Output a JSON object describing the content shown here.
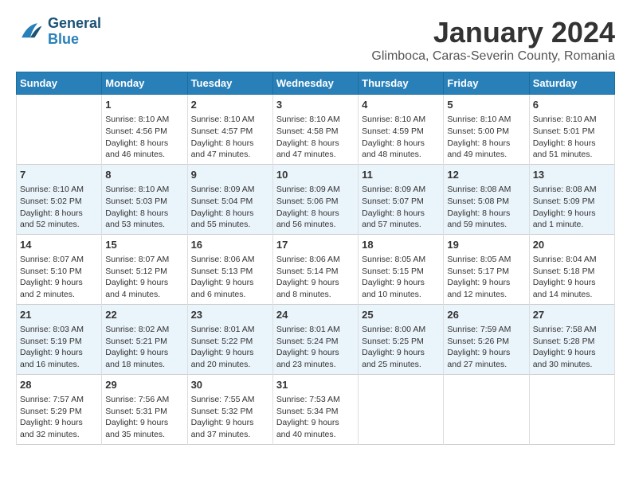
{
  "header": {
    "logo_line1": "General",
    "logo_line2": "Blue",
    "month": "January 2024",
    "location": "Glimboca, Caras-Severin County, Romania"
  },
  "columns": [
    "Sunday",
    "Monday",
    "Tuesday",
    "Wednesday",
    "Thursday",
    "Friday",
    "Saturday"
  ],
  "weeks": [
    [
      {
        "day": "",
        "info": ""
      },
      {
        "day": "1",
        "info": "Sunrise: 8:10 AM\nSunset: 4:56 PM\nDaylight: 8 hours\nand 46 minutes."
      },
      {
        "day": "2",
        "info": "Sunrise: 8:10 AM\nSunset: 4:57 PM\nDaylight: 8 hours\nand 47 minutes."
      },
      {
        "day": "3",
        "info": "Sunrise: 8:10 AM\nSunset: 4:58 PM\nDaylight: 8 hours\nand 47 minutes."
      },
      {
        "day": "4",
        "info": "Sunrise: 8:10 AM\nSunset: 4:59 PM\nDaylight: 8 hours\nand 48 minutes."
      },
      {
        "day": "5",
        "info": "Sunrise: 8:10 AM\nSunset: 5:00 PM\nDaylight: 8 hours\nand 49 minutes."
      },
      {
        "day": "6",
        "info": "Sunrise: 8:10 AM\nSunset: 5:01 PM\nDaylight: 8 hours\nand 51 minutes."
      }
    ],
    [
      {
        "day": "7",
        "info": "Sunrise: 8:10 AM\nSunset: 5:02 PM\nDaylight: 8 hours\nand 52 minutes."
      },
      {
        "day": "8",
        "info": "Sunrise: 8:10 AM\nSunset: 5:03 PM\nDaylight: 8 hours\nand 53 minutes."
      },
      {
        "day": "9",
        "info": "Sunrise: 8:09 AM\nSunset: 5:04 PM\nDaylight: 8 hours\nand 55 minutes."
      },
      {
        "day": "10",
        "info": "Sunrise: 8:09 AM\nSunset: 5:06 PM\nDaylight: 8 hours\nand 56 minutes."
      },
      {
        "day": "11",
        "info": "Sunrise: 8:09 AM\nSunset: 5:07 PM\nDaylight: 8 hours\nand 57 minutes."
      },
      {
        "day": "12",
        "info": "Sunrise: 8:08 AM\nSunset: 5:08 PM\nDaylight: 8 hours\nand 59 minutes."
      },
      {
        "day": "13",
        "info": "Sunrise: 8:08 AM\nSunset: 5:09 PM\nDaylight: 9 hours\nand 1 minute."
      }
    ],
    [
      {
        "day": "14",
        "info": "Sunrise: 8:07 AM\nSunset: 5:10 PM\nDaylight: 9 hours\nand 2 minutes."
      },
      {
        "day": "15",
        "info": "Sunrise: 8:07 AM\nSunset: 5:12 PM\nDaylight: 9 hours\nand 4 minutes."
      },
      {
        "day": "16",
        "info": "Sunrise: 8:06 AM\nSunset: 5:13 PM\nDaylight: 9 hours\nand 6 minutes."
      },
      {
        "day": "17",
        "info": "Sunrise: 8:06 AM\nSunset: 5:14 PM\nDaylight: 9 hours\nand 8 minutes."
      },
      {
        "day": "18",
        "info": "Sunrise: 8:05 AM\nSunset: 5:15 PM\nDaylight: 9 hours\nand 10 minutes."
      },
      {
        "day": "19",
        "info": "Sunrise: 8:05 AM\nSunset: 5:17 PM\nDaylight: 9 hours\nand 12 minutes."
      },
      {
        "day": "20",
        "info": "Sunrise: 8:04 AM\nSunset: 5:18 PM\nDaylight: 9 hours\nand 14 minutes."
      }
    ],
    [
      {
        "day": "21",
        "info": "Sunrise: 8:03 AM\nSunset: 5:19 PM\nDaylight: 9 hours\nand 16 minutes."
      },
      {
        "day": "22",
        "info": "Sunrise: 8:02 AM\nSunset: 5:21 PM\nDaylight: 9 hours\nand 18 minutes."
      },
      {
        "day": "23",
        "info": "Sunrise: 8:01 AM\nSunset: 5:22 PM\nDaylight: 9 hours\nand 20 minutes."
      },
      {
        "day": "24",
        "info": "Sunrise: 8:01 AM\nSunset: 5:24 PM\nDaylight: 9 hours\nand 23 minutes."
      },
      {
        "day": "25",
        "info": "Sunrise: 8:00 AM\nSunset: 5:25 PM\nDaylight: 9 hours\nand 25 minutes."
      },
      {
        "day": "26",
        "info": "Sunrise: 7:59 AM\nSunset: 5:26 PM\nDaylight: 9 hours\nand 27 minutes."
      },
      {
        "day": "27",
        "info": "Sunrise: 7:58 AM\nSunset: 5:28 PM\nDaylight: 9 hours\nand 30 minutes."
      }
    ],
    [
      {
        "day": "28",
        "info": "Sunrise: 7:57 AM\nSunset: 5:29 PM\nDaylight: 9 hours\nand 32 minutes."
      },
      {
        "day": "29",
        "info": "Sunrise: 7:56 AM\nSunset: 5:31 PM\nDaylight: 9 hours\nand 35 minutes."
      },
      {
        "day": "30",
        "info": "Sunrise: 7:55 AM\nSunset: 5:32 PM\nDaylight: 9 hours\nand 37 minutes."
      },
      {
        "day": "31",
        "info": "Sunrise: 7:53 AM\nSunset: 5:34 PM\nDaylight: 9 hours\nand 40 minutes."
      },
      {
        "day": "",
        "info": ""
      },
      {
        "day": "",
        "info": ""
      },
      {
        "day": "",
        "info": ""
      }
    ]
  ]
}
